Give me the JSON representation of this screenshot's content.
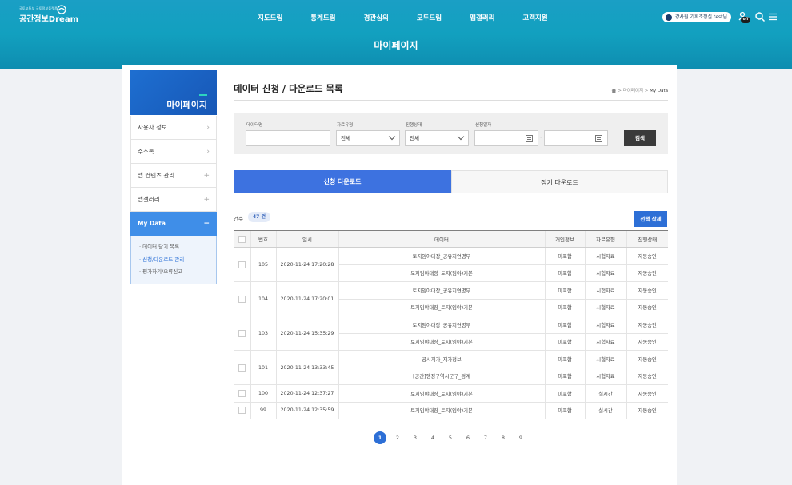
{
  "header": {
    "logo_sub": "국토교통부 국토정보플랫폼",
    "logo_main": "공간정보Dream",
    "nav": [
      "지도드림",
      "통계드림",
      "경관심의",
      "모두드림",
      "맵갤러리",
      "고객지원"
    ],
    "user_label": "강사원 기획조정실 test님",
    "off_label": "off",
    "page_title": "마이페이지"
  },
  "sidebar": {
    "title": "마이페이지",
    "items": [
      {
        "label": "사용자 정보",
        "indicator": "›"
      },
      {
        "label": "주소록",
        "indicator": "›"
      },
      {
        "label": "맵 컨텐츠 관리",
        "indicator": "+"
      },
      {
        "label": "맵갤러리",
        "indicator": "+"
      },
      {
        "label": "My Data",
        "indicator": "−"
      }
    ],
    "sub_items": [
      "· 데이터 담기 목록",
      "· 신청/다운로드 관리",
      "· 평가하기/오류신고"
    ]
  },
  "content": {
    "title": "데이터 신청 / 다운로드 목록",
    "breadcrumb": "> 마이페이지 > ",
    "breadcrumb_current": "My Data"
  },
  "filter": {
    "data_name_label": "데이터명",
    "data_name_value": "",
    "type_label": "자료유형",
    "type_value": "전체",
    "status_label": "진행상태",
    "status_value": "전체",
    "date_label": "신청일자",
    "date_sep": "-",
    "search_button": "검색"
  },
  "tabs": {
    "active": "신청 다운로드",
    "inactive": "정기 다운로드"
  },
  "summary": {
    "count_label": "건수",
    "count_value": "47 건",
    "delete_button": "선택 삭제"
  },
  "table": {
    "headers": [
      "번호",
      "일시",
      "데이터",
      "개인정보",
      "자료유형",
      "진행상태"
    ],
    "groups": [
      {
        "no": "105",
        "date": "2020-11-24 17:20:28",
        "rows": [
          {
            "data": "토지임야대장_공유지연명부",
            "privacy": "미포함",
            "type": "시험자료",
            "status": "자동승인"
          },
          {
            "data": "토지임야대장_토지(임야)기본",
            "privacy": "미포함",
            "type": "시험자료",
            "status": "자동승인"
          }
        ]
      },
      {
        "no": "104",
        "date": "2020-11-24 17:20:01",
        "rows": [
          {
            "data": "토지임야대장_공유지연명부",
            "privacy": "미포함",
            "type": "시험자료",
            "status": "자동승인"
          },
          {
            "data": "토지임야대장_토지(임야)기본",
            "privacy": "미포함",
            "type": "시험자료",
            "status": "자동승인"
          }
        ]
      },
      {
        "no": "103",
        "date": "2020-11-24 15:35:29",
        "rows": [
          {
            "data": "토지임야대장_공유지연명부",
            "privacy": "미포함",
            "type": "시험자료",
            "status": "자동승인"
          },
          {
            "data": "토지임야대장_토지(임야)기본",
            "privacy": "미포함",
            "type": "시험자료",
            "status": "자동승인"
          }
        ]
      },
      {
        "no": "101",
        "date": "2020-11-24 13:33:45",
        "rows": [
          {
            "data": "공시지가_지가정보",
            "privacy": "미포함",
            "type": "시험자료",
            "status": "자동승인"
          },
          {
            "data": "[공간]행정구역시군구_경계",
            "privacy": "미포함",
            "type": "시험자료",
            "status": "자동승인"
          }
        ]
      },
      {
        "no": "100",
        "date": "2020-11-24 12:37:27",
        "rows": [
          {
            "data": "토지임야대장_토지(임야)기본",
            "privacy": "미포함",
            "type": "실시간",
            "status": "자동승인"
          }
        ]
      },
      {
        "no": "99",
        "date": "2020-11-24 12:35:59",
        "rows": [
          {
            "data": "토지임야대장_토지(임야)기본",
            "privacy": "미포함",
            "type": "실시간",
            "status": "자동승인"
          }
        ]
      }
    ]
  },
  "pagination": {
    "pages": [
      "1",
      "2",
      "3",
      "4",
      "5",
      "6",
      "7",
      "8",
      "9"
    ],
    "current": "1"
  },
  "colors": {
    "header": "#12a0bf",
    "primary": "#2d6fd6",
    "sidebar_head": "#1e6fd1"
  }
}
